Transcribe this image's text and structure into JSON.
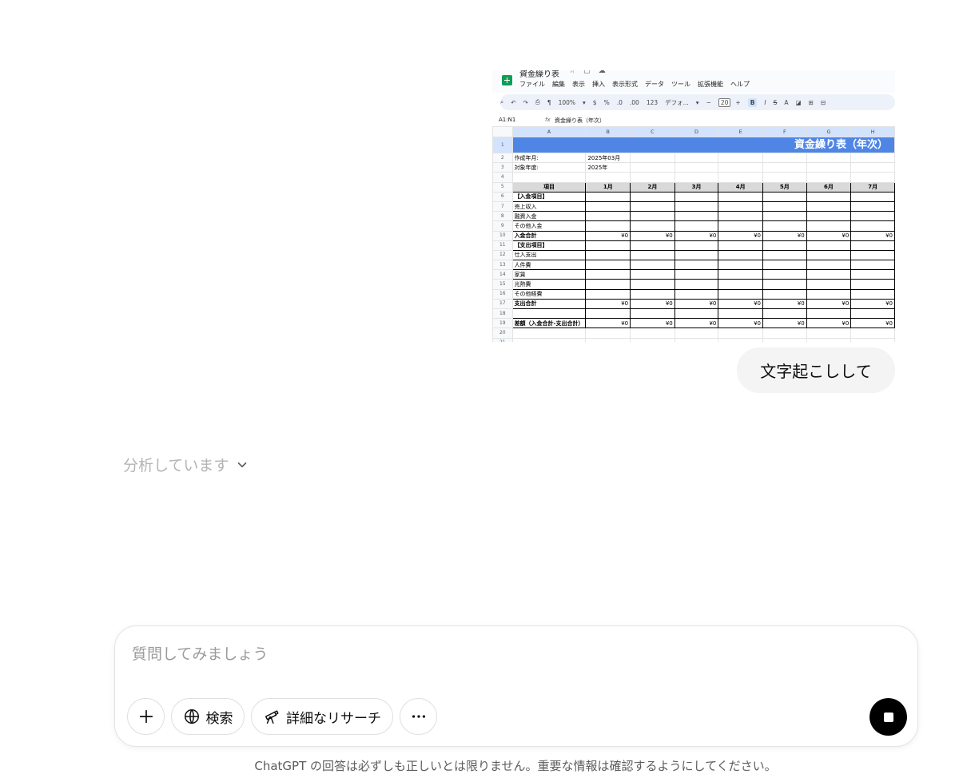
{
  "sheet": {
    "doc_title": "資金繰り表",
    "menu": [
      "ファイル",
      "編集",
      "表示",
      "挿入",
      "表示形式",
      "データ",
      "ツール",
      "拡張機能",
      "ヘルプ"
    ],
    "toolbar": {
      "zoom": "100%",
      "currency": "$",
      "percent": "%",
      "dec_less": ".0",
      "dec_more": ".00",
      "number_format": "123",
      "font": "デフォ...",
      "font_size": "20",
      "bold": "B",
      "italic": "I",
      "strike": "S",
      "text_color": "A"
    },
    "name_box": "A1:N1",
    "fx": "fx",
    "formula": "資金繰り表（年次）",
    "col_headers": [
      "A",
      "B",
      "C",
      "D",
      "E",
      "F",
      "G",
      "H"
    ],
    "row1_title": "資金繰り表（年次）",
    "row2": {
      "label": "作成年月:",
      "value": "2025年03月"
    },
    "row3": {
      "label": "対象年度:",
      "value": "2025年"
    },
    "table_header": [
      "項目",
      "1月",
      "2月",
      "3月",
      "4月",
      "5月",
      "6月",
      "7月"
    ],
    "rows": [
      {
        "n": "6",
        "label": "【入金項目】",
        "bold": true,
        "values": [
          "",
          "",
          "",
          "",
          "",
          "",
          ""
        ]
      },
      {
        "n": "7",
        "label": "売上収入",
        "bold": false,
        "values": [
          "",
          "",
          "",
          "",
          "",
          "",
          ""
        ]
      },
      {
        "n": "8",
        "label": "融資入金",
        "bold": false,
        "values": [
          "",
          "",
          "",
          "",
          "",
          "",
          ""
        ]
      },
      {
        "n": "9",
        "label": "その他入金",
        "bold": false,
        "values": [
          "",
          "",
          "",
          "",
          "",
          "",
          ""
        ]
      },
      {
        "n": "10",
        "label": "入金合計",
        "bold": true,
        "values": [
          "¥0",
          "¥0",
          "¥0",
          "¥0",
          "¥0",
          "¥0",
          "¥0"
        ]
      },
      {
        "n": "11",
        "label": "【支出項目】",
        "bold": true,
        "values": [
          "",
          "",
          "",
          "",
          "",
          "",
          ""
        ]
      },
      {
        "n": "12",
        "label": "仕入支出",
        "bold": false,
        "values": [
          "",
          "",
          "",
          "",
          "",
          "",
          ""
        ]
      },
      {
        "n": "13",
        "label": "人件費",
        "bold": false,
        "values": [
          "",
          "",
          "",
          "",
          "",
          "",
          ""
        ]
      },
      {
        "n": "14",
        "label": "家賃",
        "bold": false,
        "values": [
          "",
          "",
          "",
          "",
          "",
          "",
          ""
        ]
      },
      {
        "n": "15",
        "label": "光熱費",
        "bold": false,
        "values": [
          "",
          "",
          "",
          "",
          "",
          "",
          ""
        ]
      },
      {
        "n": "16",
        "label": "その他経費",
        "bold": false,
        "values": [
          "",
          "",
          "",
          "",
          "",
          "",
          ""
        ]
      },
      {
        "n": "17",
        "label": "支出合計",
        "bold": true,
        "values": [
          "¥0",
          "¥0",
          "¥0",
          "¥0",
          "¥0",
          "¥0",
          "¥0"
        ]
      },
      {
        "n": "18",
        "label": "",
        "bold": false,
        "values": [
          "",
          "",
          "",
          "",
          "",
          "",
          ""
        ]
      },
      {
        "n": "19",
        "label": "差額（入金合計-支出合計）",
        "bold": true,
        "values": [
          "¥0",
          "¥0",
          "¥0",
          "¥0",
          "¥0",
          "¥0",
          "¥0"
        ]
      }
    ],
    "empty_rows": [
      "4",
      "20",
      "21"
    ]
  },
  "chat": {
    "user_message": "文字起こしして",
    "status": "分析しています"
  },
  "composer": {
    "placeholder": "質問してみましょう",
    "search_label": "検索",
    "research_label": "詳細なリサーチ"
  },
  "disclaimer": "ChatGPT の回答は必ずしも正しいとは限りません。重要な情報は確認するようにしてください。",
  "colors": {
    "title_fill": "#4f86e6",
    "bubble": "#f4f4f4",
    "stop_button": "#000000"
  }
}
